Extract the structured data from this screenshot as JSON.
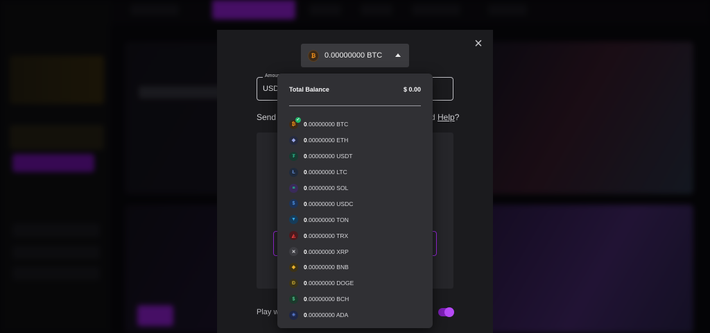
{
  "modal": {
    "selected_currency_amount": "0.00000000 BTC",
    "amount_label": "Amount",
    "amount_prefix": "USD",
    "send_text": "Send (",
    "help_prefix": "d ",
    "help_link": "Help",
    "help_suffix": "?",
    "play_text": "Play wi",
    "close_icon": "close-icon"
  },
  "dropdown": {
    "total_label": "Total Balance",
    "total_value": "$ 0.00",
    "items": [
      {
        "int": "0",
        "dec": ".00000000",
        "sym": "BTC",
        "icon": "btc-icon",
        "glyph": "₿",
        "bg": "#3c2a18",
        "fg": "#f7931a",
        "selected": true
      },
      {
        "int": "0",
        "dec": ".00000000",
        "sym": "ETH",
        "icon": "eth-icon",
        "glyph": "◆",
        "bg": "#252a3e",
        "fg": "#9aa7e8",
        "selected": false
      },
      {
        "int": "0",
        "dec": ".00000000",
        "sym": "USDT",
        "icon": "usdt-icon",
        "glyph": "₮",
        "bg": "#173a30",
        "fg": "#26a17b",
        "selected": false
      },
      {
        "int": "0",
        "dec": ".00000000",
        "sym": "LTC",
        "icon": "ltc-icon",
        "glyph": "Ł",
        "bg": "#1f2a3c",
        "fg": "#5c84c8",
        "selected": false
      },
      {
        "int": "0",
        "dec": ".00000000",
        "sym": "SOL",
        "icon": "sol-icon",
        "glyph": "≡",
        "bg": "#3a2a5a",
        "fg": "#14f195",
        "selected": false
      },
      {
        "int": "0",
        "dec": ".00000000",
        "sym": "USDC",
        "icon": "usdc-icon",
        "glyph": "$",
        "bg": "#1c3358",
        "fg": "#4a90e2",
        "selected": false
      },
      {
        "int": "0",
        "dec": ".00000000",
        "sym": "TON",
        "icon": "ton-icon",
        "glyph": "▼",
        "bg": "#163c5a",
        "fg": "#32a8e8",
        "selected": false
      },
      {
        "int": "0",
        "dec": ".00000000",
        "sym": "TRX",
        "icon": "trx-icon",
        "glyph": "◭",
        "bg": "#4a1a1e",
        "fg": "#e53b3b",
        "selected": false
      },
      {
        "int": "0",
        "dec": ".00000000",
        "sym": "XRP",
        "icon": "xrp-icon",
        "glyph": "✕",
        "bg": "#3d3d42",
        "fg": "#d8d8dc",
        "selected": false
      },
      {
        "int": "0",
        "dec": ".00000000",
        "sym": "BNB",
        "icon": "bnb-icon",
        "glyph": "◈",
        "bg": "#3c3216",
        "fg": "#f3ba2f",
        "selected": false
      },
      {
        "int": "0",
        "dec": ".00000000",
        "sym": "DOGE",
        "icon": "doge-icon",
        "glyph": "Ð",
        "bg": "#3a3318",
        "fg": "#c2a633",
        "selected": false
      },
      {
        "int": "0",
        "dec": ".00000000",
        "sym": "BCH",
        "icon": "bch-icon",
        "glyph": "$",
        "bg": "#1c3a2c",
        "fg": "#4cc38a",
        "selected": false
      },
      {
        "int": "0",
        "dec": ".00000000",
        "sym": "ADA",
        "icon": "ada-icon",
        "glyph": "✳",
        "bg": "#1e2646",
        "fg": "#5b7fd6",
        "selected": false
      }
    ]
  }
}
